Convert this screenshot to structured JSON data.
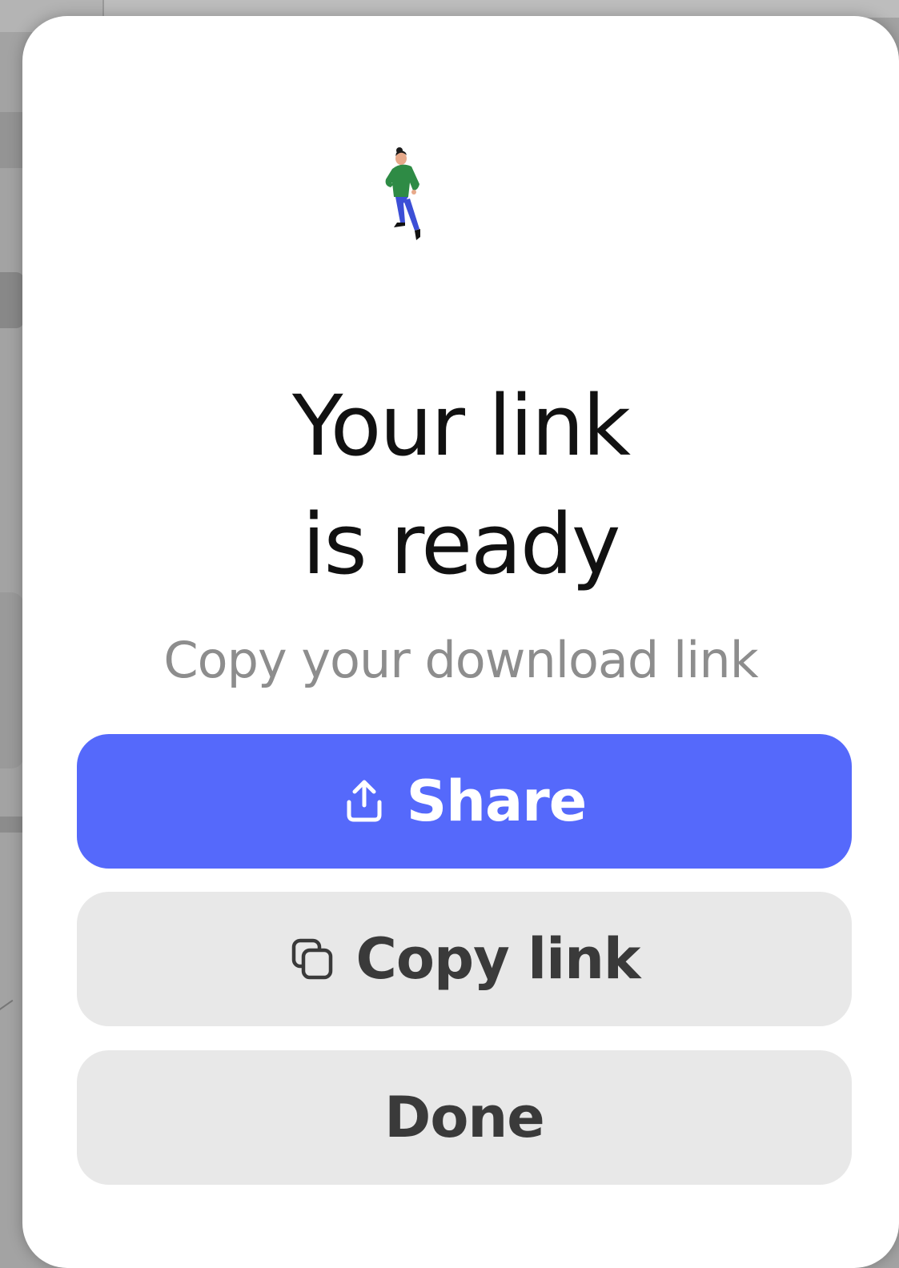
{
  "dialog": {
    "title_line1": "Your link",
    "title_line2": "is ready",
    "subtitle": "Copy your download link",
    "illustration_icon": "person-walking-illustration"
  },
  "buttons": {
    "share": {
      "label": "Share",
      "icon": "share-upload-icon",
      "color": "#5569fb"
    },
    "copy_link": {
      "label": "Copy link",
      "icon": "copy-icon"
    },
    "done": {
      "label": "Done"
    }
  }
}
